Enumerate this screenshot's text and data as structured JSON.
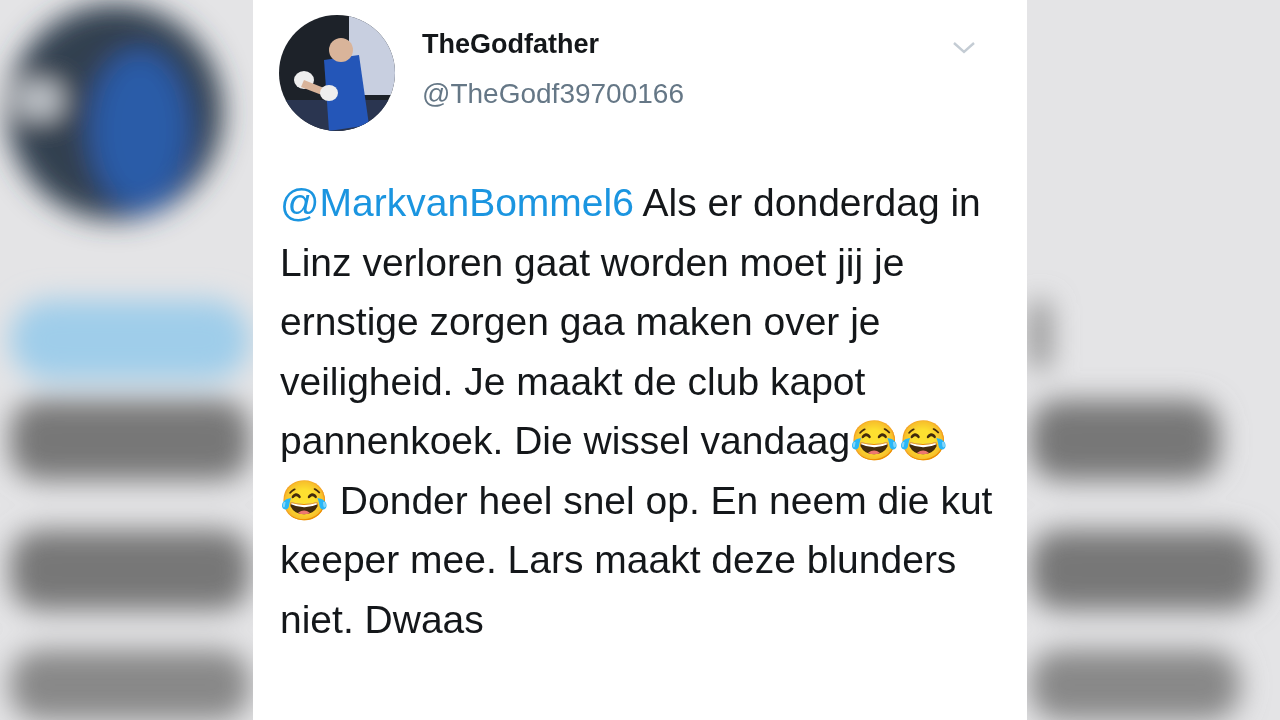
{
  "tweet": {
    "display_name": "TheGodfather",
    "handle": "@TheGodf39700166",
    "mention": "@MarkvanBommel6",
    "text": "Als er donderdag in Linz verloren gaat worden moet jij je ernstige zorgen gaa maken over je veiligheid. Je maakt de club kapot pannenkoek. Die wissel vandaag😂😂😂 Donder heel snel op. En neem die kut keeper mee. Lars maakt deze blunders niet. Dwaas"
  }
}
